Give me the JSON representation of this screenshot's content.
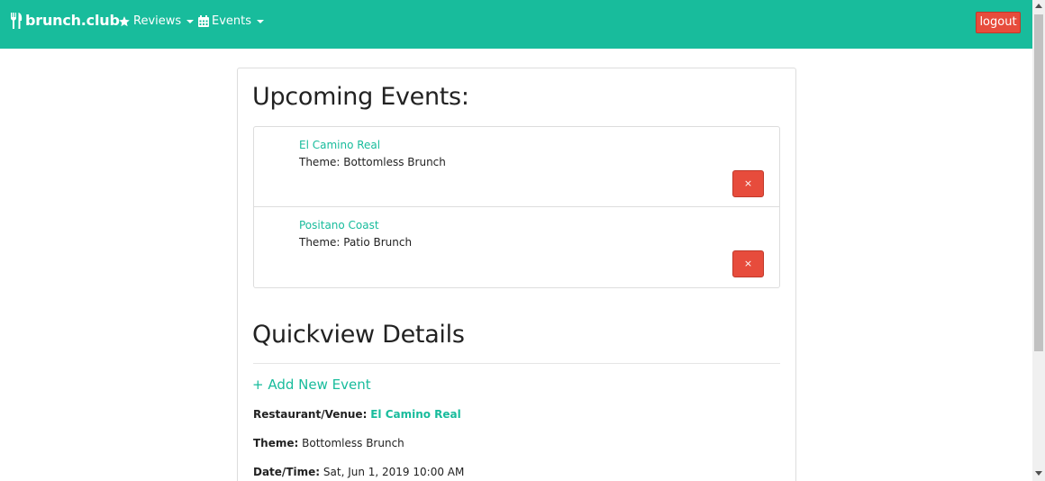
{
  "navbar": {
    "brand": "brunch.club",
    "brand_icon": "utensils-icon",
    "reviews_label": "Reviews",
    "reviews_icon": "star-icon",
    "events_label": "Events",
    "events_icon": "calendar-icon",
    "logout_label": "logout",
    "accent_color": "#18bc9c",
    "danger_color": "#e74c3c"
  },
  "upcoming": {
    "heading": "Upcoming Events:",
    "events": [
      {
        "name": "El Camino Real",
        "theme": "Theme: Bottomless Brunch",
        "delete_label": "×"
      },
      {
        "name": "Positano Coast",
        "theme": "Theme: Patio Brunch",
        "delete_label": "×"
      }
    ]
  },
  "quickview": {
    "heading": "Quickview Details",
    "add_event": "+ Add New Event",
    "venue_label": "Restaurant/Venue:",
    "venue_value": "El Camino Real",
    "theme_label": "Theme:",
    "theme_value": "Bottomless Brunch",
    "datetime_label": "Date/Time:",
    "datetime_value": "Sat, Jun 1, 2019 10:00 AM"
  }
}
